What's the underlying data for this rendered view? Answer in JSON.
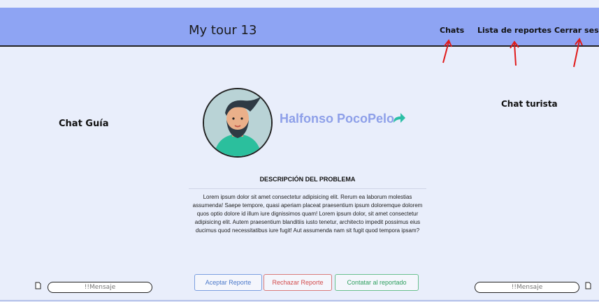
{
  "header": {
    "brand": "My tour 13",
    "nav": {
      "chats": "Chats",
      "reports": "Lista de reportes",
      "logout": "Cerrar sesion"
    }
  },
  "chat_guide": {
    "title": "Chat Guía",
    "placeholder": "!!Mensaje"
  },
  "chat_tourist": {
    "title": "Chat turista",
    "placeholder": "!!Mensaje"
  },
  "profile": {
    "name": "Halfonso PocoPelo"
  },
  "report": {
    "title": "DESCRIPCIÓN DEL PROBLEMA",
    "text": "Lorem ipsum dolor sit amet consectetur adipisicing elit. Rerum ea laborum molestias assumenda! Saepe tempore, quasi aperiam placeat praesentium ipsum doloremque dolorem quos optio dolore id illum iure dignissimos quam! Lorem ipsum dolor, sit amet consectetur adipisicing elit. Autem praesentium blanditiis iusto tenetur, architecto impedit possimus eius ducimus quod necessitatibus iure fugit! Aut assumenda nam sit fugit quod tempora ipsam?"
  },
  "actions": {
    "accept": "Aceptar Reporte",
    "reject": "Rechazar Reporte",
    "contact": "Contatar al reportado"
  },
  "colors": {
    "header": "#8ea4f3",
    "background": "#e9eefb",
    "accent_name": "#8ea0e9",
    "share": "#2bbfa6",
    "arrow": "#e01b1b"
  }
}
